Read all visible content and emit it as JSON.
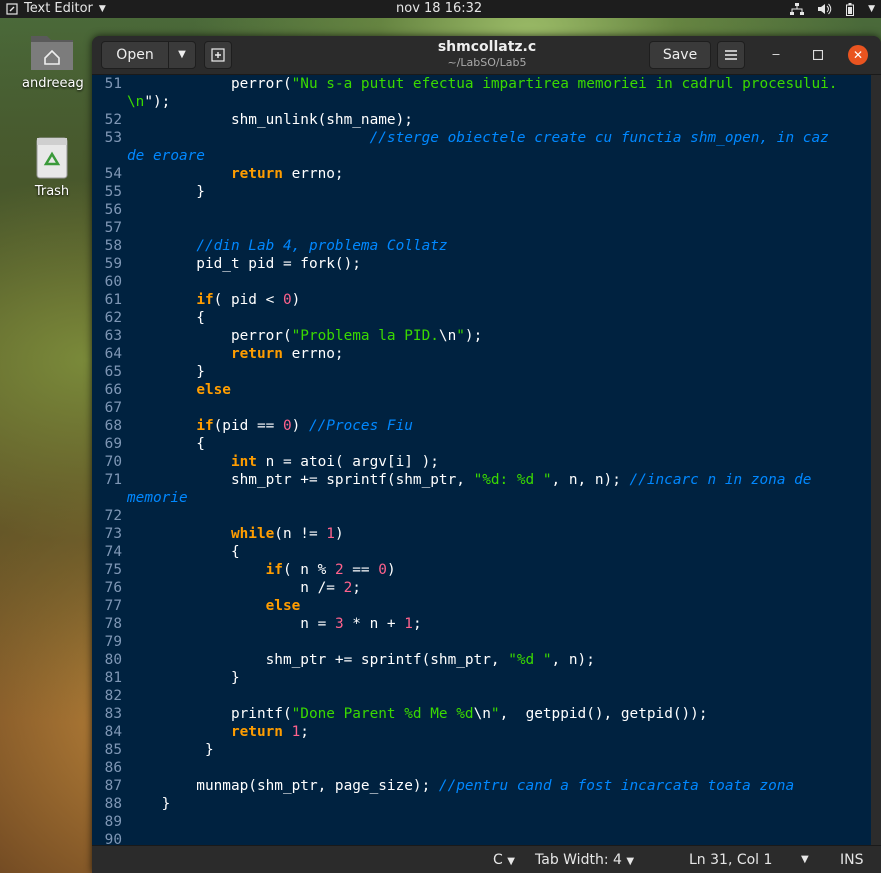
{
  "topbar": {
    "app_name": "Text Editor",
    "clock": "nov 18  16:32"
  },
  "desktop": {
    "home_label": "andreeag",
    "trash_label": "Trash"
  },
  "window": {
    "open_label": "Open",
    "title": "shmcollatz.c",
    "subtitle": "~/LabSO/Lab5",
    "save_label": "Save",
    "close_color": "#e95420"
  },
  "editor": {
    "lines": [
      {
        "n": "51",
        "segs": [
          {
            "c": "p",
            "t": "            perror("
          },
          {
            "c": "str",
            "t": "\"Nu s-a putut efectua impartirea memoriei in cadrul procesului."
          }
        ]
      },
      {
        "n": "",
        "segs": [
          {
            "c": "str",
            "t": "\\n"
          },
          {
            "c": "p",
            "t": "\");"
          }
        ]
      },
      {
        "n": "52",
        "segs": [
          {
            "c": "p",
            "t": "            shm_unlink(shm_name);"
          }
        ]
      },
      {
        "n": "53",
        "segs": [
          {
            "c": "p",
            "t": "                            "
          },
          {
            "c": "cmt",
            "t": "//sterge obiectele create cu functia shm_open, in caz"
          }
        ]
      },
      {
        "n": "",
        "segs": [
          {
            "c": "cmt",
            "t": "de eroare"
          }
        ]
      },
      {
        "n": "54",
        "segs": [
          {
            "c": "p",
            "t": "            "
          },
          {
            "c": "kw",
            "t": "return"
          },
          {
            "c": "p",
            "t": " errno;"
          }
        ]
      },
      {
        "n": "55",
        "segs": [
          {
            "c": "p",
            "t": "        }"
          }
        ]
      },
      {
        "n": "56",
        "segs": []
      },
      {
        "n": "57",
        "segs": []
      },
      {
        "n": "58",
        "segs": [
          {
            "c": "p",
            "t": "        "
          },
          {
            "c": "cmt",
            "t": "//din Lab 4, problema Collatz"
          }
        ]
      },
      {
        "n": "59",
        "segs": [
          {
            "c": "p",
            "t": "        pid_t pid = fork();"
          }
        ]
      },
      {
        "n": "60",
        "segs": []
      },
      {
        "n": "61",
        "segs": [
          {
            "c": "p",
            "t": "        "
          },
          {
            "c": "kw",
            "t": "if"
          },
          {
            "c": "p",
            "t": "( pid < "
          },
          {
            "c": "num",
            "t": "0"
          },
          {
            "c": "p",
            "t": ")"
          }
        ]
      },
      {
        "n": "62",
        "segs": [
          {
            "c": "p",
            "t": "        {"
          }
        ]
      },
      {
        "n": "63",
        "segs": [
          {
            "c": "p",
            "t": "            perror("
          },
          {
            "c": "str",
            "t": "\"Problema la PID."
          },
          {
            "c": "esc",
            "t": "\\n"
          },
          {
            "c": "str",
            "t": "\""
          },
          {
            "c": "p",
            "t": ");"
          }
        ]
      },
      {
        "n": "64",
        "segs": [
          {
            "c": "p",
            "t": "            "
          },
          {
            "c": "kw",
            "t": "return"
          },
          {
            "c": "p",
            "t": " errno;"
          }
        ]
      },
      {
        "n": "65",
        "segs": [
          {
            "c": "p",
            "t": "        }"
          }
        ]
      },
      {
        "n": "66",
        "segs": [
          {
            "c": "p",
            "t": "        "
          },
          {
            "c": "kw",
            "t": "else"
          }
        ]
      },
      {
        "n": "67",
        "segs": []
      },
      {
        "n": "68",
        "segs": [
          {
            "c": "p",
            "t": "        "
          },
          {
            "c": "kw",
            "t": "if"
          },
          {
            "c": "p",
            "t": "(pid == "
          },
          {
            "c": "num",
            "t": "0"
          },
          {
            "c": "p",
            "t": ") "
          },
          {
            "c": "cmt",
            "t": "//Proces Fiu"
          }
        ]
      },
      {
        "n": "69",
        "segs": [
          {
            "c": "p",
            "t": "        {"
          }
        ]
      },
      {
        "n": "70",
        "segs": [
          {
            "c": "p",
            "t": "            "
          },
          {
            "c": "kw",
            "t": "int"
          },
          {
            "c": "p",
            "t": " n = atoi( argv[i] );"
          }
        ]
      },
      {
        "n": "71",
        "segs": [
          {
            "c": "p",
            "t": "            shm_ptr += sprintf(shm_ptr, "
          },
          {
            "c": "str",
            "t": "\"%d: %d \""
          },
          {
            "c": "p",
            "t": ", n, n); "
          },
          {
            "c": "cmt",
            "t": "//incarc n in zona de"
          }
        ]
      },
      {
        "n": "",
        "segs": [
          {
            "c": "cmt",
            "t": "memorie"
          }
        ]
      },
      {
        "n": "72",
        "segs": []
      },
      {
        "n": "73",
        "segs": [
          {
            "c": "p",
            "t": "            "
          },
          {
            "c": "kw",
            "t": "while"
          },
          {
            "c": "p",
            "t": "(n != "
          },
          {
            "c": "num",
            "t": "1"
          },
          {
            "c": "p",
            "t": ")"
          }
        ]
      },
      {
        "n": "74",
        "segs": [
          {
            "c": "p",
            "t": "            {"
          }
        ]
      },
      {
        "n": "75",
        "segs": [
          {
            "c": "p",
            "t": "                "
          },
          {
            "c": "kw",
            "t": "if"
          },
          {
            "c": "p",
            "t": "( n % "
          },
          {
            "c": "num",
            "t": "2"
          },
          {
            "c": "p",
            "t": " == "
          },
          {
            "c": "num",
            "t": "0"
          },
          {
            "c": "p",
            "t": ")"
          }
        ]
      },
      {
        "n": "76",
        "segs": [
          {
            "c": "p",
            "t": "                    n /= "
          },
          {
            "c": "num",
            "t": "2"
          },
          {
            "c": "p",
            "t": ";"
          }
        ]
      },
      {
        "n": "77",
        "segs": [
          {
            "c": "p",
            "t": "                "
          },
          {
            "c": "kw",
            "t": "else"
          }
        ]
      },
      {
        "n": "78",
        "segs": [
          {
            "c": "p",
            "t": "                    n = "
          },
          {
            "c": "num",
            "t": "3"
          },
          {
            "c": "p",
            "t": " * n + "
          },
          {
            "c": "num",
            "t": "1"
          },
          {
            "c": "p",
            "t": ";"
          }
        ]
      },
      {
        "n": "79",
        "segs": []
      },
      {
        "n": "80",
        "segs": [
          {
            "c": "p",
            "t": "                shm_ptr += sprintf(shm_ptr, "
          },
          {
            "c": "str",
            "t": "\"%d \""
          },
          {
            "c": "p",
            "t": ", n);"
          }
        ]
      },
      {
        "n": "81",
        "segs": [
          {
            "c": "p",
            "t": "            }"
          }
        ]
      },
      {
        "n": "82",
        "segs": []
      },
      {
        "n": "83",
        "segs": [
          {
            "c": "p",
            "t": "            printf("
          },
          {
            "c": "str",
            "t": "\"Done Parent %d Me %d"
          },
          {
            "c": "esc",
            "t": "\\n"
          },
          {
            "c": "str",
            "t": "\""
          },
          {
            "c": "p",
            "t": ",  getppid(), getpid());"
          }
        ]
      },
      {
        "n": "84",
        "segs": [
          {
            "c": "p",
            "t": "            "
          },
          {
            "c": "kw",
            "t": "return"
          },
          {
            "c": "p",
            "t": " "
          },
          {
            "c": "num",
            "t": "1"
          },
          {
            "c": "p",
            "t": ";"
          }
        ]
      },
      {
        "n": "85",
        "segs": [
          {
            "c": "p",
            "t": "         }"
          }
        ]
      },
      {
        "n": "86",
        "segs": []
      },
      {
        "n": "87",
        "segs": [
          {
            "c": "p",
            "t": "        munmap(shm_ptr, page_size); "
          },
          {
            "c": "cmt",
            "t": "//pentru cand a fost incarcata toata zona"
          }
        ]
      },
      {
        "n": "88",
        "segs": [
          {
            "c": "p",
            "t": "    }"
          }
        ]
      },
      {
        "n": "89",
        "segs": []
      },
      {
        "n": "90",
        "segs": []
      }
    ]
  },
  "statusbar": {
    "language": "C",
    "tab_width": "Tab Width: 4",
    "position": "Ln 31, Col 1",
    "mode": "INS"
  }
}
